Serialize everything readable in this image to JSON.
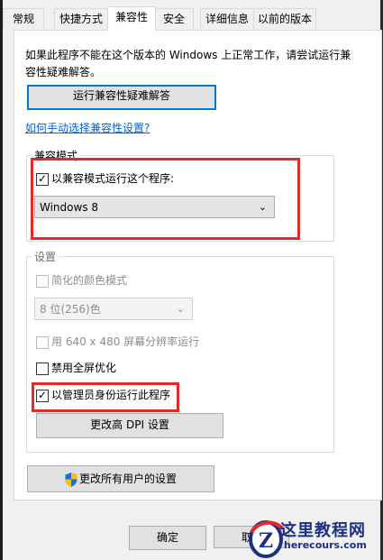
{
  "tabs": [
    {
      "label": "常规"
    },
    {
      "label": "快捷方式"
    },
    {
      "label": "兼容性"
    },
    {
      "label": "安全"
    },
    {
      "label": "详细信息"
    },
    {
      "label": "以前的版本"
    }
  ],
  "description": "如果此程序不能在这个版本的 Windows 上正常工作，请尝试运行兼容性疑难解答。",
  "run_troubleshooter_label": "运行兼容性疑难解答",
  "manual_link": "如何手动选择兼容性设置?",
  "compat_mode": {
    "legend": "兼容模式",
    "checkbox_label": "以兼容模式运行这个程序:",
    "checked": true,
    "selected_os": "Windows 8"
  },
  "settings": {
    "legend": "设置",
    "reduced_color_label": "简化的颜色模式",
    "color_depth_value": "8 位(256)色",
    "res_640_label": "用 640 x 480 屏幕分辨率运行",
    "disable_fullscreen_label": "禁用全屏优化",
    "run_as_admin_label": "以管理员身份运行此程序",
    "run_as_admin_checked": true,
    "change_dpi_label": "更改高 DPI 设置"
  },
  "change_all_users_label": "更改所有用户的设置",
  "ok_label": "确定",
  "cancel_label_partial": "取",
  "watermark": {
    "title": "这里教程网",
    "url": "herecours.com"
  },
  "colors": {
    "highlight_red": "#e32a2a",
    "focus_blue": "#0078d7",
    "link_blue": "#0066cc"
  }
}
